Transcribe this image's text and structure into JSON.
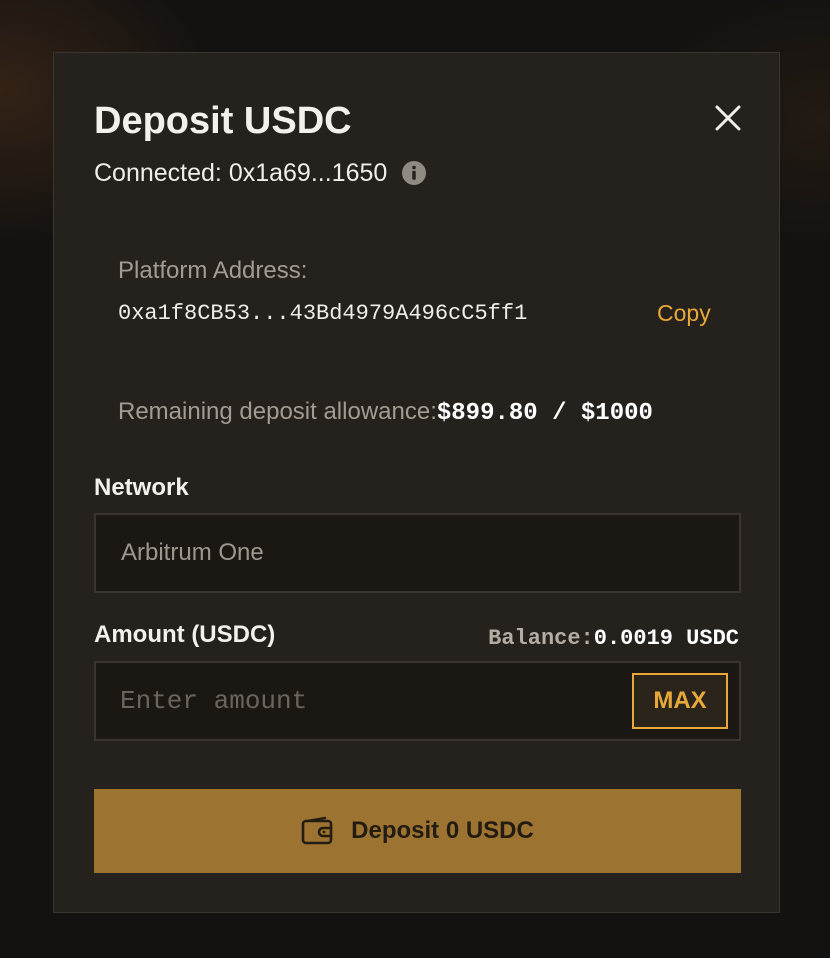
{
  "modal": {
    "title": "Deposit USDC",
    "connected_text": "Connected: 0x1a69...1650",
    "close_icon": "close-icon",
    "info_icon": "info-icon"
  },
  "platform": {
    "label": "Platform Address:",
    "address": "0xa1f8CB53...43Bd4979A496cC5ff1",
    "copy_label": "Copy"
  },
  "allowance": {
    "label": "Remaining deposit allowance:",
    "value": "$899.80 / $1000"
  },
  "network": {
    "label": "Network",
    "selected": "Arbitrum One"
  },
  "amount": {
    "label": "Amount (USDC)",
    "balance_label": "Balance:",
    "balance_value": "0.0019 USDC",
    "placeholder": "Enter amount",
    "value": "",
    "max_label": "MAX"
  },
  "deposit_button": {
    "label": "Deposit 0 USDC",
    "icon": "wallet-icon"
  },
  "colors": {
    "accent": "#e8a93a",
    "button_bg": "#9c7331",
    "modal_bg": "#25211c",
    "field_bg": "#1b1814"
  }
}
